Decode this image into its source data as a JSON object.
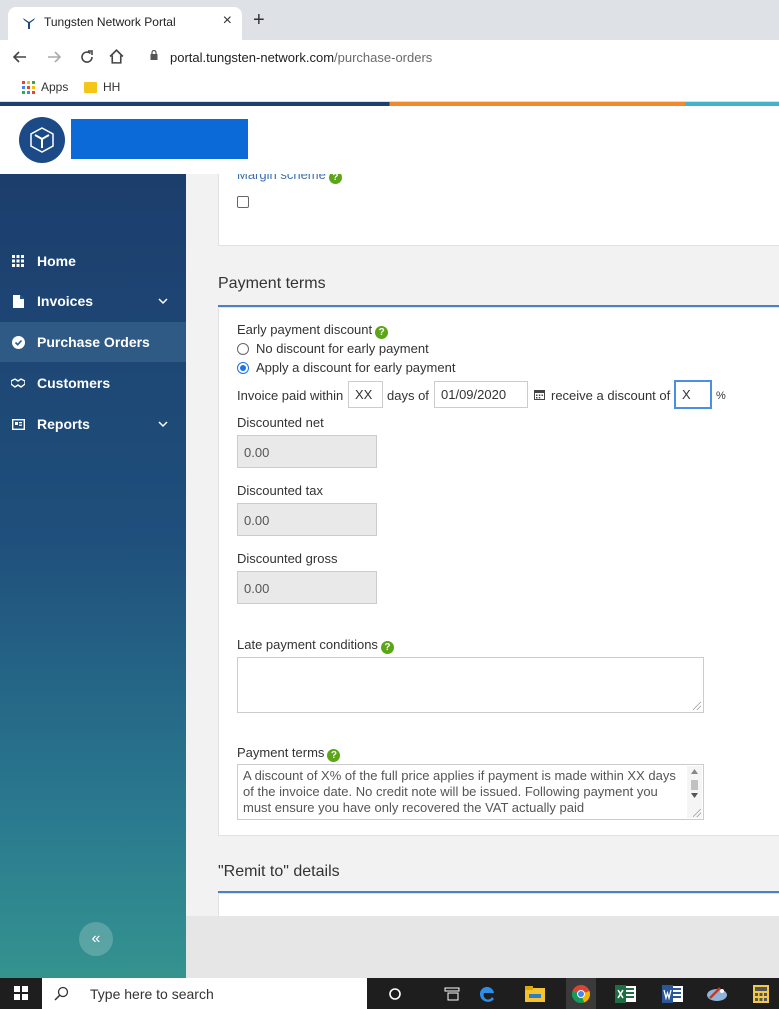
{
  "browser": {
    "tab_title": "Tungsten Network Portal",
    "tab_close": "×",
    "new_tab": "+",
    "url_host": "portal.tungsten-network.com",
    "url_path": "/purchase-orders",
    "bookmarks": [
      {
        "label": "Apps",
        "icon": "apps-grid-icon"
      },
      {
        "label": "HH",
        "icon": "folder-icon"
      }
    ]
  },
  "sidebar": {
    "items": [
      {
        "label": "Home",
        "icon": "grid-icon",
        "expandable": false,
        "active": false
      },
      {
        "label": "Invoices",
        "icon": "document-icon",
        "expandable": true,
        "active": false
      },
      {
        "label": "Purchase Orders",
        "icon": "check-circle-icon",
        "expandable": false,
        "active": true
      },
      {
        "label": "Customers",
        "icon": "handshake-icon",
        "expandable": false,
        "active": false
      },
      {
        "label": "Reports",
        "icon": "report-icon",
        "expandable": true,
        "active": false
      }
    ],
    "collapse_label": "«"
  },
  "margin_scheme": {
    "label": "Margin scheme",
    "checked": false
  },
  "payment_terms_section": {
    "title": "Payment terms",
    "early_payment_discount_label": "Early payment discount",
    "options": [
      {
        "label": "No discount for early payment",
        "selected": false
      },
      {
        "label": "Apply a discount for early payment",
        "selected": true
      }
    ],
    "invoice_paid_within_label": "Invoice paid within",
    "days_value": "XX",
    "days_of_label": "days of",
    "date_value": "01/09/2020",
    "receive_discount_label": "receive a discount of",
    "discount_value": "X",
    "percent_label": "%",
    "discounted_net_label": "Discounted net",
    "discounted_net_value": "0.00",
    "discounted_tax_label": "Discounted tax",
    "discounted_tax_value": "0.00",
    "discounted_gross_label": "Discounted gross",
    "discounted_gross_value": "0.00",
    "late_payment_label": "Late payment conditions",
    "late_payment_value": "",
    "payment_terms_label": "Payment terms",
    "payment_terms_text": "A discount of X% of the full price applies if payment is made within XX days of the invoice date. No credit note will be issued. Following payment you must ensure you have only recovered the VAT actually paid"
  },
  "remit_to": {
    "title": "\"Remit to\" details"
  },
  "taskbar": {
    "search_placeholder": "Type here to search"
  },
  "colors": {
    "sidebar_top": "#1c3e6d",
    "sidebar_bottom": "#34938f",
    "accent_blue": "#1b3f73",
    "accent_orange": "#f08a2c",
    "accent_teal": "#43b3c9",
    "help_green": "#5aa617",
    "header_block": "#0b6ad8"
  }
}
